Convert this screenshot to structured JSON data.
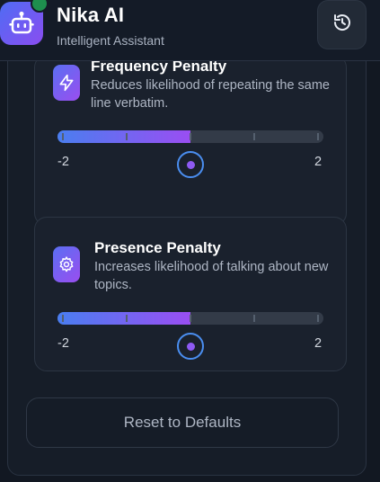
{
  "header": {
    "title": "Nika AI",
    "subtitle": "Intelligent Assistant",
    "avatar_icon": "robot-icon",
    "action_icon": "history-icon",
    "status_color": "#1e8f4e"
  },
  "settings": {
    "frequency_penalty": {
      "title": "Frequency Penalty",
      "description": "Reduces likelihood of repeating the same line verbatim.",
      "icon": "lightning-icon",
      "min_label": "-2",
      "max_label": "2",
      "min": -2,
      "max": 2,
      "value": 0
    },
    "presence_penalty": {
      "title": "Presence Penalty",
      "description": "Increases likelihood of talking about new topics.",
      "icon": "gear-icon",
      "min_label": "-2",
      "max_label": "2",
      "min": -2,
      "max": 2,
      "value": 0
    }
  },
  "actions": {
    "reset_label": "Reset to Defaults"
  },
  "colors": {
    "accent_start": "#4a7ef0",
    "accent_end": "#9a4ef2",
    "background": "#121822"
  }
}
